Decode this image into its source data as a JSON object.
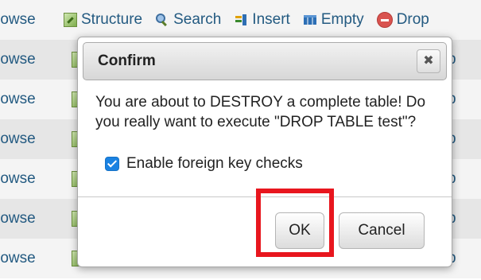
{
  "table_actions": {
    "browse": "Browse",
    "structure": "Structure",
    "search": "Search",
    "insert": "Insert",
    "empty": "Empty",
    "drop": "Drop",
    "row_browse_partial": "rowse",
    "row_trailing_partial": "p"
  },
  "dialog": {
    "title": "Confirm",
    "close_label": "✖",
    "message": "You are about to DESTROY a complete table! Do you really want to execute \"DROP TABLE test\"?",
    "checkbox_label": "Enable foreign key checks",
    "checkbox_checked": true,
    "ok_label": "OK",
    "cancel_label": "Cancel"
  },
  "colors": {
    "link_blue": "#235a81",
    "checkbox_blue": "#1a82e2",
    "highlight_red": "#e8161e"
  }
}
